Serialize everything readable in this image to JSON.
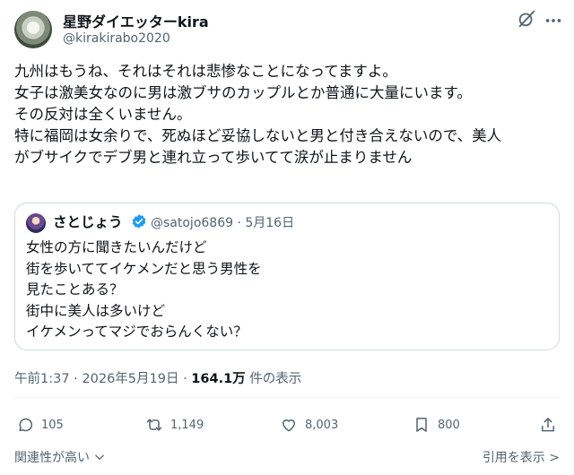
{
  "author": {
    "display_name": "星野ダイエッターkira",
    "handle": "@kirakirabo2020"
  },
  "post": {
    "lines": [
      "九州はもうね、それはそれは悲惨なことになってますよ。",
      "女子は激美女なのに男は激ブサのカップルとか普通に大量にいます。",
      "その反対は全くいません。",
      "特に福岡は女余りで、死ぬほど妥協しないと男と付き合えないので、美人",
      "がブサイクでデブ男と連れ立って歩いてて涙が止まりません"
    ]
  },
  "quote": {
    "display_name": "さとじょう",
    "handle_date": "@satojo6869 · 5月16日",
    "lines": [
      "女性の方に聞きたいんだけど",
      "街を歩いててイケメンだと思う男性を",
      "見たことある？",
      "街中に美人は多いけど",
      "イケメンってマジでおらんくない？"
    ]
  },
  "meta": {
    "time_date": "午前1:37 · 2026年5月19日 · ",
    "views": "164.1万",
    "views_suffix": " 件の表示"
  },
  "actions": {
    "replies": "105",
    "reposts": "1,149",
    "likes": "8,003",
    "bookmarks": "800"
  },
  "footer": {
    "sort_label": "関連性が高い",
    "quotes_link": "引用を表示 >"
  },
  "colors": {
    "text": "#0f1419",
    "secondary": "#536471",
    "border": "#cfd9de",
    "verified": "#1d9bf0"
  }
}
